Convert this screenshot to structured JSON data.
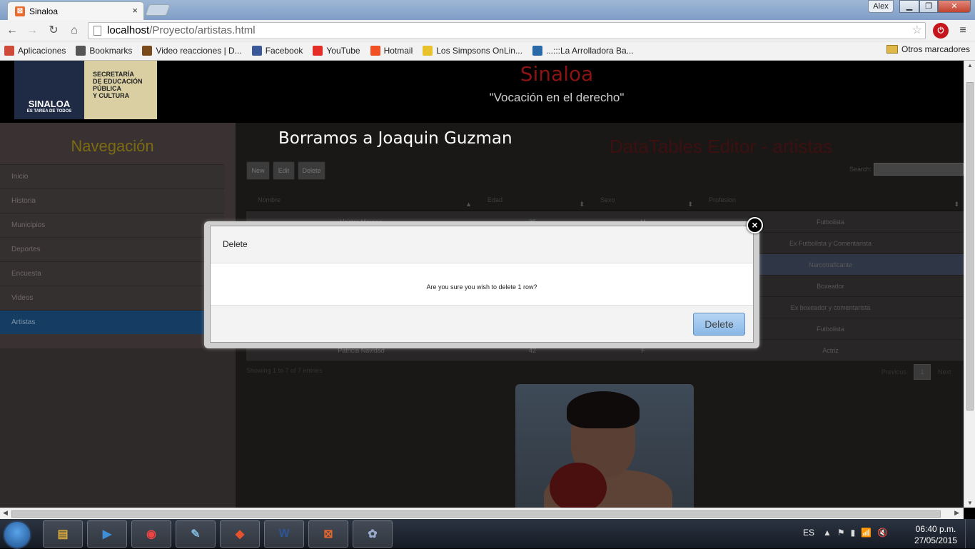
{
  "browser": {
    "tab_title": "Sinaloa",
    "tab_close": "×",
    "user": "Alex",
    "url_host": "localhost",
    "url_path": "/Proyecto/artistas.html",
    "bookmarks": [
      {
        "label": "Aplicaciones",
        "icon": "apps-grid-icon",
        "color": "#d04a3a"
      },
      {
        "label": "Bookmarks",
        "icon": "star-icon",
        "color": "#555555"
      },
      {
        "label": "Video reacciones | D...",
        "icon": "bookmark-favicon-icon",
        "color": "#7a4a1a"
      },
      {
        "label": "Facebook",
        "icon": "facebook-icon",
        "color": "#3b5998"
      },
      {
        "label": "YouTube",
        "icon": "youtube-icon",
        "color": "#e52d27"
      },
      {
        "label": "Hotmail",
        "icon": "windows-logo-icon",
        "color": "#f25022"
      },
      {
        "label": "Los Simpsons OnLin...",
        "icon": "simpsons-icon",
        "color": "#e8c22a"
      },
      {
        "label": "...:::La Arrolladora Ba...",
        "icon": "globe-icon",
        "color": "#2a6aa8"
      }
    ],
    "other_bookmarks": "Otros marcadores"
  },
  "site": {
    "logo_text": "SINALOA",
    "logo_tagline": "ES TAREA DE TODOS",
    "logo_secretaria": "SECRETARÍA\nDE EDUCACIÓN\nPÚBLICA\nY CULTURA",
    "title": "Sinaloa",
    "motto": "\"Vocación en el derecho\""
  },
  "sidebar": {
    "title": "Navegación",
    "items": [
      {
        "label": "Inicio"
      },
      {
        "label": "Historia"
      },
      {
        "label": "Municipios"
      },
      {
        "label": "Deportes"
      },
      {
        "label": "Encuesta"
      },
      {
        "label": "Videos"
      },
      {
        "label": "Artistas",
        "active": true
      }
    ]
  },
  "main": {
    "overlay_note": "Borramos a Joaquin Guzman",
    "title": "DataTables Editor - artistas",
    "buttons": {
      "new": "New",
      "edit": "Edit",
      "delete": "Delete"
    },
    "search_label": "Search:",
    "columns": [
      "Nombre",
      "Edad",
      "Sexo",
      "Profesion"
    ],
    "rows": [
      {
        "nombre": "Hector Moreno",
        "edad": "25",
        "sexo": "M",
        "profesion": "Futbolista"
      },
      {
        "nombre": "",
        "edad": "",
        "sexo": "",
        "profesion": "Ex Futbolista y Comentarista"
      },
      {
        "nombre": "",
        "edad": "",
        "sexo": "",
        "profesion": "Narcotraficante",
        "selected": true
      },
      {
        "nombre": "",
        "edad": "",
        "sexo": "",
        "profesion": "Boxeador"
      },
      {
        "nombre": "",
        "edad": "",
        "sexo": "",
        "profesion": "Ex boxeador y comentarista"
      },
      {
        "nombre": "",
        "edad": "",
        "sexo": "",
        "profesion": "Futbolista"
      },
      {
        "nombre": "Patricia Navidad",
        "edad": "42",
        "sexo": "F",
        "profesion": "Actriz"
      }
    ],
    "info": "Showing 1 to 7 of 7 entries",
    "pagination": {
      "previous": "Previous",
      "current": "1",
      "next": "Next"
    }
  },
  "modal": {
    "title": "Delete",
    "message": "Are you sure you wish to delete 1 row?",
    "button": "Delete",
    "close": "×"
  },
  "taskbar": {
    "apps": [
      "Explorer",
      "Media",
      "Chrome",
      "Notepad",
      "Git",
      "Word",
      "XAMPP",
      "Paint"
    ],
    "lang": "ES",
    "time": "06:40 p.m.",
    "date": "27/05/2015"
  }
}
